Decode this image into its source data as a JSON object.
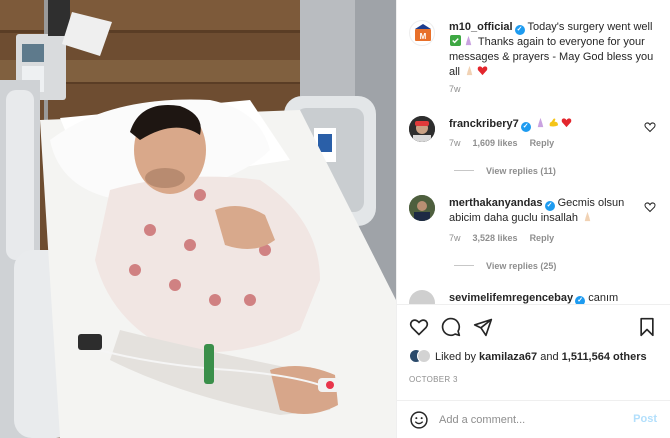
{
  "post": {
    "author": "m10_official",
    "caption": "Today's surgery went well",
    "caption_rest": "Thanks again to everyone for your messages & prayers - May God bless you all",
    "time": "7w"
  },
  "comments": [
    {
      "user": "franckribery7",
      "text": "",
      "time": "7w",
      "likes": "1,609 likes",
      "reply_label": "Reply",
      "view_replies": "View replies (11)"
    },
    {
      "user": "merthakanyandas",
      "text": "Gecmis olsun abicim daha guclu insallah",
      "time": "7w",
      "likes": "3,528 likes",
      "reply_label": "Reply",
      "view_replies": "View replies (25)"
    },
    {
      "user": "sevimelifemregencebay",
      "text": "canım"
    }
  ],
  "likes": {
    "prefix": "Liked by",
    "user": "kamilaza67",
    "middle": "and",
    "count": "1,511,564 others"
  },
  "date": "OCTOBER 3",
  "add_comment": {
    "placeholder": "Add a comment...",
    "post_label": "Post"
  },
  "colors": {
    "verified": "#1d9bf0",
    "post_button": "#b2dffc",
    "heart": "#ed4956"
  },
  "icons": [
    "heart-icon",
    "comment-icon",
    "share-icon",
    "bookmark-icon",
    "emoji-icon",
    "verified-icon"
  ]
}
